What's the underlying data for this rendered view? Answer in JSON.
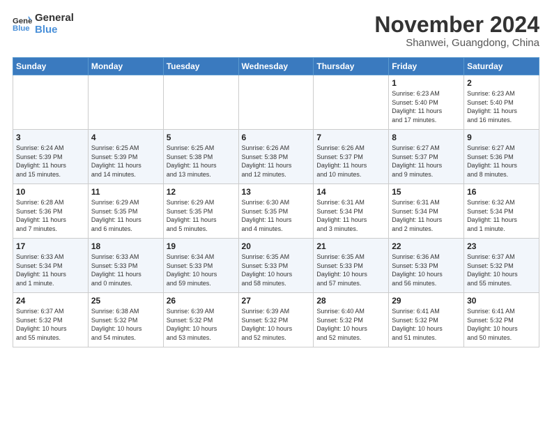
{
  "logo": {
    "line1": "General",
    "line2": "Blue"
  },
  "title": "November 2024",
  "location": "Shanwei, Guangdong, China",
  "weekdays": [
    "Sunday",
    "Monday",
    "Tuesday",
    "Wednesday",
    "Thursday",
    "Friday",
    "Saturday"
  ],
  "weeks": [
    [
      {
        "day": "",
        "info": ""
      },
      {
        "day": "",
        "info": ""
      },
      {
        "day": "",
        "info": ""
      },
      {
        "day": "",
        "info": ""
      },
      {
        "day": "",
        "info": ""
      },
      {
        "day": "1",
        "info": "Sunrise: 6:23 AM\nSunset: 5:40 PM\nDaylight: 11 hours\nand 17 minutes."
      },
      {
        "day": "2",
        "info": "Sunrise: 6:23 AM\nSunset: 5:40 PM\nDaylight: 11 hours\nand 16 minutes."
      }
    ],
    [
      {
        "day": "3",
        "info": "Sunrise: 6:24 AM\nSunset: 5:39 PM\nDaylight: 11 hours\nand 15 minutes."
      },
      {
        "day": "4",
        "info": "Sunrise: 6:25 AM\nSunset: 5:39 PM\nDaylight: 11 hours\nand 14 minutes."
      },
      {
        "day": "5",
        "info": "Sunrise: 6:25 AM\nSunset: 5:38 PM\nDaylight: 11 hours\nand 13 minutes."
      },
      {
        "day": "6",
        "info": "Sunrise: 6:26 AM\nSunset: 5:38 PM\nDaylight: 11 hours\nand 12 minutes."
      },
      {
        "day": "7",
        "info": "Sunrise: 6:26 AM\nSunset: 5:37 PM\nDaylight: 11 hours\nand 10 minutes."
      },
      {
        "day": "8",
        "info": "Sunrise: 6:27 AM\nSunset: 5:37 PM\nDaylight: 11 hours\nand 9 minutes."
      },
      {
        "day": "9",
        "info": "Sunrise: 6:27 AM\nSunset: 5:36 PM\nDaylight: 11 hours\nand 8 minutes."
      }
    ],
    [
      {
        "day": "10",
        "info": "Sunrise: 6:28 AM\nSunset: 5:36 PM\nDaylight: 11 hours\nand 7 minutes."
      },
      {
        "day": "11",
        "info": "Sunrise: 6:29 AM\nSunset: 5:35 PM\nDaylight: 11 hours\nand 6 minutes."
      },
      {
        "day": "12",
        "info": "Sunrise: 6:29 AM\nSunset: 5:35 PM\nDaylight: 11 hours\nand 5 minutes."
      },
      {
        "day": "13",
        "info": "Sunrise: 6:30 AM\nSunset: 5:35 PM\nDaylight: 11 hours\nand 4 minutes."
      },
      {
        "day": "14",
        "info": "Sunrise: 6:31 AM\nSunset: 5:34 PM\nDaylight: 11 hours\nand 3 minutes."
      },
      {
        "day": "15",
        "info": "Sunrise: 6:31 AM\nSunset: 5:34 PM\nDaylight: 11 hours\nand 2 minutes."
      },
      {
        "day": "16",
        "info": "Sunrise: 6:32 AM\nSunset: 5:34 PM\nDaylight: 11 hours\nand 1 minute."
      }
    ],
    [
      {
        "day": "17",
        "info": "Sunrise: 6:33 AM\nSunset: 5:34 PM\nDaylight: 11 hours\nand 1 minute."
      },
      {
        "day": "18",
        "info": "Sunrise: 6:33 AM\nSunset: 5:33 PM\nDaylight: 11 hours\nand 0 minutes."
      },
      {
        "day": "19",
        "info": "Sunrise: 6:34 AM\nSunset: 5:33 PM\nDaylight: 10 hours\nand 59 minutes."
      },
      {
        "day": "20",
        "info": "Sunrise: 6:35 AM\nSunset: 5:33 PM\nDaylight: 10 hours\nand 58 minutes."
      },
      {
        "day": "21",
        "info": "Sunrise: 6:35 AM\nSunset: 5:33 PM\nDaylight: 10 hours\nand 57 minutes."
      },
      {
        "day": "22",
        "info": "Sunrise: 6:36 AM\nSunset: 5:33 PM\nDaylight: 10 hours\nand 56 minutes."
      },
      {
        "day": "23",
        "info": "Sunrise: 6:37 AM\nSunset: 5:32 PM\nDaylight: 10 hours\nand 55 minutes."
      }
    ],
    [
      {
        "day": "24",
        "info": "Sunrise: 6:37 AM\nSunset: 5:32 PM\nDaylight: 10 hours\nand 55 minutes."
      },
      {
        "day": "25",
        "info": "Sunrise: 6:38 AM\nSunset: 5:32 PM\nDaylight: 10 hours\nand 54 minutes."
      },
      {
        "day": "26",
        "info": "Sunrise: 6:39 AM\nSunset: 5:32 PM\nDaylight: 10 hours\nand 53 minutes."
      },
      {
        "day": "27",
        "info": "Sunrise: 6:39 AM\nSunset: 5:32 PM\nDaylight: 10 hours\nand 52 minutes."
      },
      {
        "day": "28",
        "info": "Sunrise: 6:40 AM\nSunset: 5:32 PM\nDaylight: 10 hours\nand 52 minutes."
      },
      {
        "day": "29",
        "info": "Sunrise: 6:41 AM\nSunset: 5:32 PM\nDaylight: 10 hours\nand 51 minutes."
      },
      {
        "day": "30",
        "info": "Sunrise: 6:41 AM\nSunset: 5:32 PM\nDaylight: 10 hours\nand 50 minutes."
      }
    ]
  ]
}
